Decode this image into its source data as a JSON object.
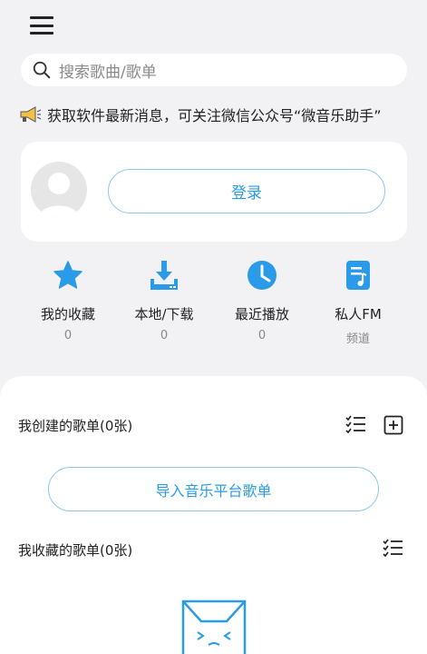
{
  "search": {
    "placeholder": "搜索歌曲/歌单"
  },
  "notice": {
    "text": "获取软件最新消息，可关注微信公众号“微音乐助手”"
  },
  "account": {
    "login_label": "登录"
  },
  "quick_actions": [
    {
      "label": "我的收藏",
      "sub": "0",
      "icon": "star-icon"
    },
    {
      "label": "本地/下载",
      "sub": "0",
      "icon": "download-icon"
    },
    {
      "label": "最近播放",
      "sub": "0",
      "icon": "clock-icon"
    },
    {
      "label": "私人FM",
      "sub": "频道",
      "icon": "music-note-icon"
    }
  ],
  "created_playlists": {
    "title": "我创建的歌单(0张)",
    "import_label": "导入音乐平台歌单"
  },
  "collected_playlists": {
    "title": "我收藏的歌单(0张)"
  },
  "colors": {
    "accent": "#2a9be8",
    "accent_border": "#8fc8ee",
    "background": "#f2f2f4"
  }
}
